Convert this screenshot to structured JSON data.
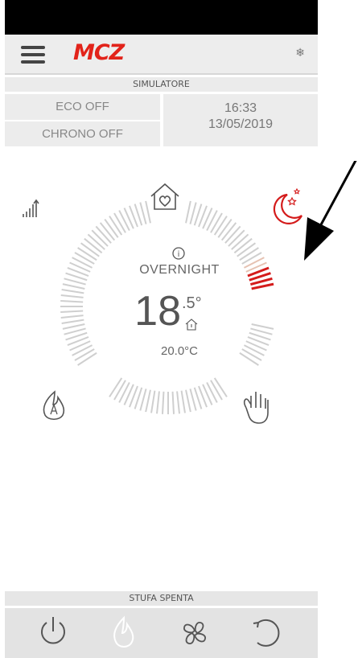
{
  "header": {
    "brand": "MCZ"
  },
  "simulator_label": "SIMULATORE",
  "status": {
    "eco": "ECO OFF",
    "chrono": "CHRONO OFF",
    "time": "16:33",
    "date": "13/05/2019"
  },
  "dial": {
    "mode": "OVERNIGHT",
    "temperature_int": "18",
    "temperature_dec": ".5°",
    "setpoint": "20.0°C"
  },
  "footer": {
    "status": "STUFA SPENTA"
  },
  "icons": {
    "menu": "menu-icon",
    "snow": "snowflake-icon",
    "home": "home-heart-icon",
    "bars": "power-level-icon",
    "night": "night-moon-icon",
    "auto": "auto-flame-icon",
    "manual": "hand-icon",
    "info": "info-icon",
    "house_small": "house-thermometer-icon",
    "power": "power-icon",
    "flame": "flame-icon",
    "fan": "fan-icon",
    "refresh": "refresh-icon"
  },
  "colors": {
    "brand": "#e2231a",
    "accent": "#d41b1b",
    "tick": "#c9c9c9"
  }
}
